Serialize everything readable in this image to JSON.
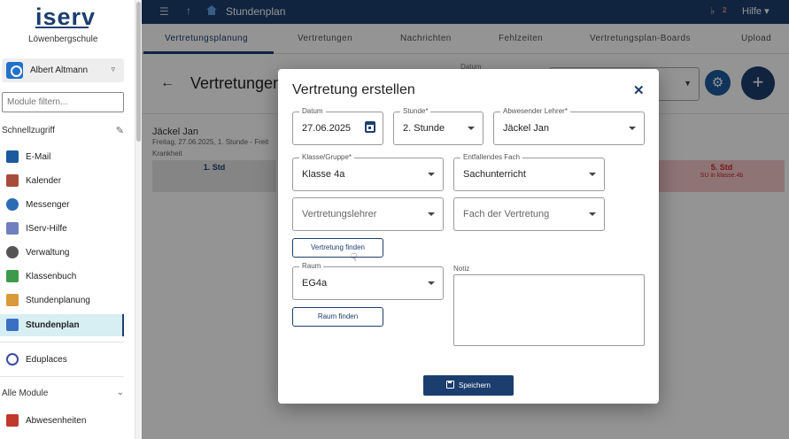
{
  "app": {
    "logo_text": "iserv",
    "school": "Löwenbergschule",
    "user_name": "Albert Altmann"
  },
  "sidebar": {
    "filter_placeholder": "Module filtern...",
    "quick_access_label": "Schnellzugriff",
    "items": [
      {
        "label": "E-Mail",
        "icon": "mail-icon"
      },
      {
        "label": "Kalender",
        "icon": "calendar-icon"
      },
      {
        "label": "Messenger",
        "icon": "chat-icon"
      },
      {
        "label": "IServ-Hilfe",
        "icon": "help-icon"
      },
      {
        "label": "Verwaltung",
        "icon": "gear-icon"
      },
      {
        "label": "Klassenbuch",
        "icon": "book-icon"
      },
      {
        "label": "Stundenplanung",
        "icon": "planning-icon"
      },
      {
        "label": "Stundenplan",
        "icon": "timetable-icon"
      }
    ],
    "eduplaces": "Eduplaces",
    "all_modules_label": "Alle Module",
    "abwesenheiten": "Abwesenheiten"
  },
  "topbar": {
    "title": "Stundenplan",
    "notifications_count": "2",
    "help_label": "Hilfe"
  },
  "tabs": [
    "Vertretungsplanung",
    "Vertretungen",
    "Nachrichten",
    "Fehlzeiten",
    "Vertretungsplan-Boards",
    "Upload"
  ],
  "page": {
    "title": "Vertretungen",
    "date_label": "Datum"
  },
  "background": {
    "teacher": "Jäckel Jan",
    "subline": "Freitag, 27.06.2025, 1. Stunde - Freit",
    "reason": "Krankheit",
    "std1": "1. Std",
    "std5": "5. Std",
    "std5_sub": "SU in klasse.4b"
  },
  "modal": {
    "title": "Vertretung erstellen",
    "datum_label": "Datum",
    "datum_value": "27.06.2025",
    "stunde_label": "Stunde*",
    "stunde_value": "2. Stunde",
    "lehrer_label": "Abwesender Lehrer*",
    "lehrer_value": "Jäckel Jan",
    "klasse_label": "Klasse/Gruppe*",
    "klasse_value": "Klasse 4a",
    "fach_label": "Entfallendes Fach",
    "fach_value": "Sachunterricht",
    "vertretungslehrer_placeholder": "Vertretungslehrer",
    "fach_vertretung_placeholder": "Fach der Vertretung",
    "find_vertretung_label": "Vertretung finden",
    "raum_label": "Raum",
    "raum_value": "EG4a",
    "notiz_label": "Notiz",
    "find_raum_label": "Raum finden",
    "save_label": "Speichern"
  }
}
